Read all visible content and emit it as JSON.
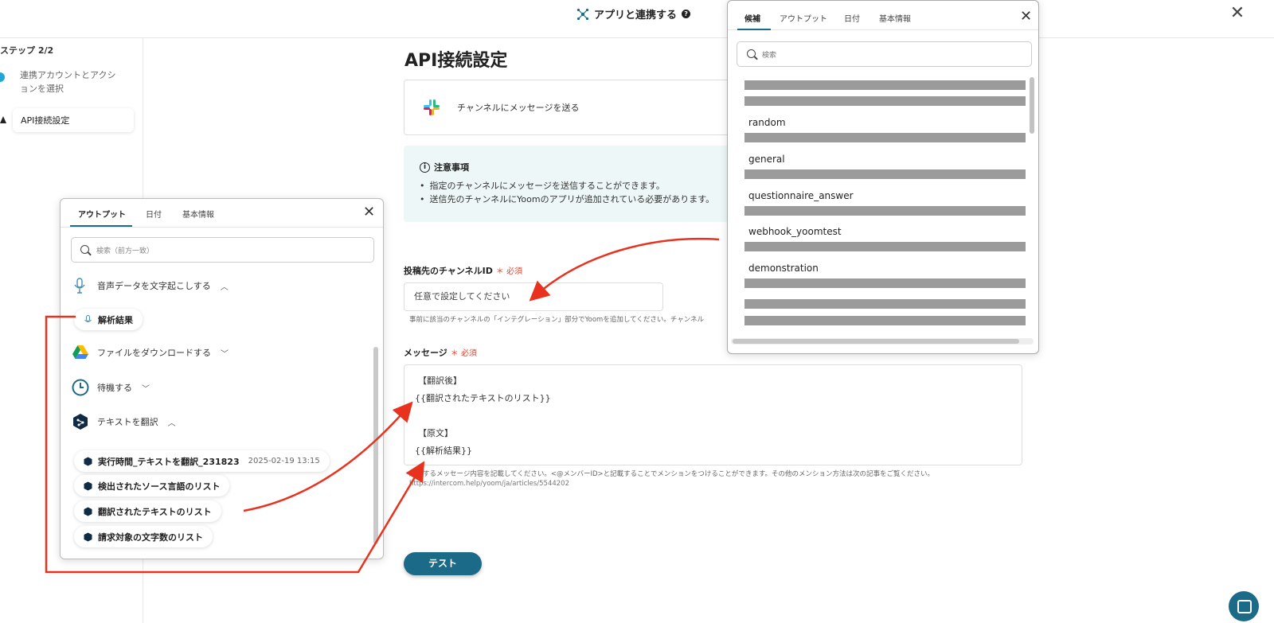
{
  "header": {
    "title": "アプリと連携する"
  },
  "sidebar": {
    "step_label": "ステップ 2/2",
    "steps": [
      {
        "label": "連携アカウントとアクションを選択"
      },
      {
        "label": "API接続設定"
      }
    ]
  },
  "main": {
    "title": "API接続設定",
    "action_label": "チャンネルにメッセージを送る",
    "notice": {
      "title": "注意事項",
      "items": [
        "指定のチャンネルにメッセージを送信することができます。",
        "送信先のチャンネルにYoomのアプリが追加されている必要があります。"
      ]
    },
    "channel_field": {
      "label": "投稿先のチャンネルID",
      "required": "＊ 必須",
      "value": "任意で設定してください",
      "help": "事前に該当のチャンネルの「インテグレーション」部分でYoomを追加してください。チャンネル"
    },
    "message_field": {
      "label": "メッセージ",
      "required": "＊ 必須",
      "lines": [
        "【翻訳後】",
        "{{翻訳されたテキストのリスト}}",
        "",
        "【原文】",
        "{{解析結果}}"
      ],
      "help": "送信するメッセージ内容を記載してください。<@メンバーID>と記載することでメンションをつけることができます。その他のメンション方法は次の記事をご覧ください。",
      "link": "https://intercom.help/yoom/ja/articles/5544202"
    },
    "test_button": "テスト"
  },
  "left_popup": {
    "tabs": [
      "アウトプット",
      "日付",
      "基本情報"
    ],
    "search_placeholder": "検索（前方一致）",
    "sections": [
      {
        "label": "音声データを文字起こしする",
        "expanded": true,
        "icon": "voice-icon"
      },
      {
        "label": "ファイルをダウンロードする",
        "expanded": false,
        "icon": "google-drive-icon"
      },
      {
        "label": "待機する",
        "expanded": false,
        "icon": "clock-icon"
      },
      {
        "label": "テキストを翻訳",
        "expanded": true,
        "icon": "deepl-icon"
      }
    ],
    "chips": {
      "voice_result": "解析結果",
      "run_time": "実行時間_テキストを翻訳_231823",
      "run_time_date": "2025-02-19 13:15",
      "source_lang": "検出されたソース言語のリスト",
      "translated": "翻訳されたテキストのリスト",
      "char_count": "請求対象の文字数のリスト"
    }
  },
  "right_popup": {
    "tabs": [
      "候補",
      "アウトプット",
      "日付",
      "基本情報"
    ],
    "search_placeholder": "検索",
    "channels": [
      "random",
      "general",
      "questionnaire_answer",
      "webhook_yoomtest",
      "demonstration"
    ]
  },
  "colors": {
    "accent": "#1b6a87",
    "arrow": "#e8321e",
    "notice_bg": "#eef7f7",
    "required": "#e0452f"
  }
}
